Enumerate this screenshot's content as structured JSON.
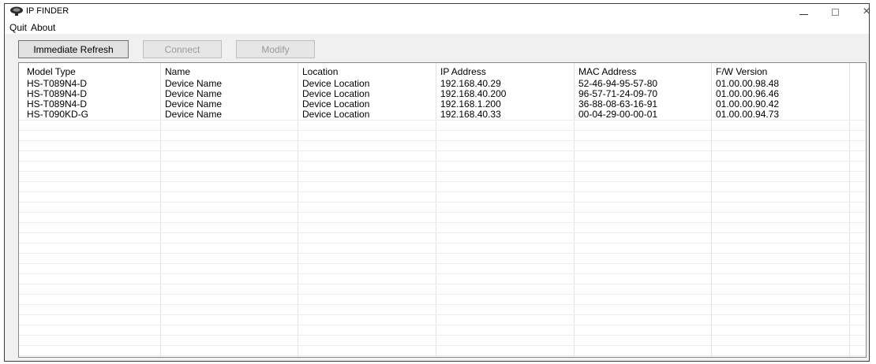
{
  "window": {
    "title": "IP FINDER",
    "icon": "ip-finder-camera-icon"
  },
  "window_controls": {
    "minimize": "minimize-icon",
    "maximize": "maximize-icon",
    "close": "×"
  },
  "menu": {
    "quit": "Quit",
    "about": "About"
  },
  "toolbar": {
    "refresh_label": "Immediate Refresh",
    "connect_label": "Connect",
    "modify_label": "Modify",
    "connect_enabled": false,
    "modify_enabled": false
  },
  "table": {
    "columns": [
      "Model Type",
      "Name",
      "Location",
      "IP Address",
      "MAC Address",
      "F/W Version"
    ],
    "rows": [
      [
        "HS-T089N4-D",
        "Device Name",
        "Device Location",
        "192.168.40.29",
        "52-46-94-95-57-80",
        "01.00.00.98.48"
      ],
      [
        "HS-T089N4-D",
        "Device Name",
        "Device Location",
        "192.168.40.200",
        "96-57-71-24-09-70",
        "01.00.00.96.46"
      ],
      [
        "HS-T089N4-D",
        "Device Name",
        "Device Location",
        "192.168.1.200",
        "36-88-08-63-16-91",
        "01.00.00.90.42"
      ],
      [
        "HS-T090KD-G",
        "Device Name",
        "Device Location",
        "192.168.40.33",
        "00-04-29-00-00-01",
        "01.00.00.94.73"
      ]
    ]
  }
}
